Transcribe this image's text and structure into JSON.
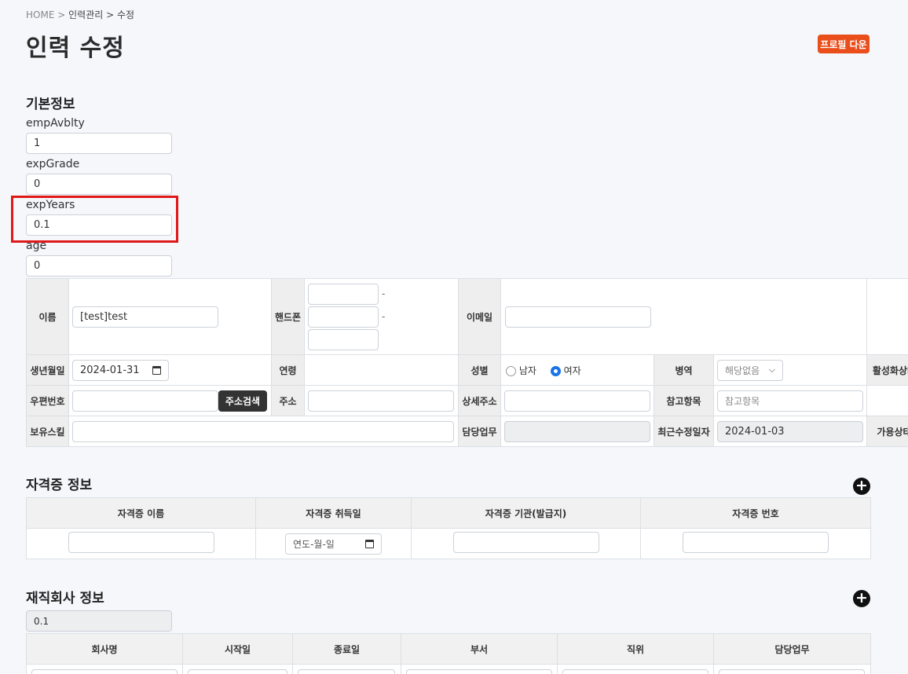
{
  "breadcrumb": {
    "home": "HOME",
    "sep1": ">",
    "mid": "인력관리",
    "sep2": ">",
    "cur": "수정"
  },
  "title": "인력 수정",
  "profile_btn": "프로필 다운",
  "basic": {
    "title": "기본정보",
    "fields": [
      {
        "label": "empAvblty",
        "value": "1"
      },
      {
        "label": "expGrade",
        "value": "0"
      },
      {
        "label": "expYears",
        "value": "0.1"
      },
      {
        "label": "age",
        "value": "0"
      }
    ]
  },
  "grid": {
    "name_label": "이름",
    "name_value": "[test]test",
    "phone_label": "핸드폰",
    "phone_dash": "-",
    "email_label": "이메일",
    "birth_label": "생년월일",
    "birth_value": "2024-01-31",
    "age_label": "연령",
    "gender_label": "성별",
    "gender_male": "남자",
    "gender_female": "여자",
    "military_label": "병역",
    "military_value": "해당없음",
    "active_label": "활성화상태",
    "zip_label": "우편번호",
    "addr_search_btn": "주소검색",
    "addr_label": "주소",
    "detail_addr_label": "상세주소",
    "ref_label": "참고항목",
    "ref_placeholder": "참고항목",
    "skill_label": "보유스킬",
    "duty_label": "담당업무",
    "updated_label": "최근수정일자",
    "updated_value": "2024-01-03",
    "avail_label": "가용상태"
  },
  "cert": {
    "title": "자격증 정보",
    "headers": [
      "자격증 이름",
      "자격증 취득일",
      "자격증 기관(발급지)",
      "자격증 번호"
    ],
    "date_placeholder": "연도-월-일"
  },
  "company": {
    "title": "재직회사 정보",
    "value": "0.1",
    "headers": [
      "회사명",
      "시작일",
      "종료일",
      "부서",
      "직위",
      "담당업무"
    ]
  },
  "colors": {
    "accent": "#e94e1b",
    "highlight": "#e01818",
    "radio": "#1a73e8"
  }
}
